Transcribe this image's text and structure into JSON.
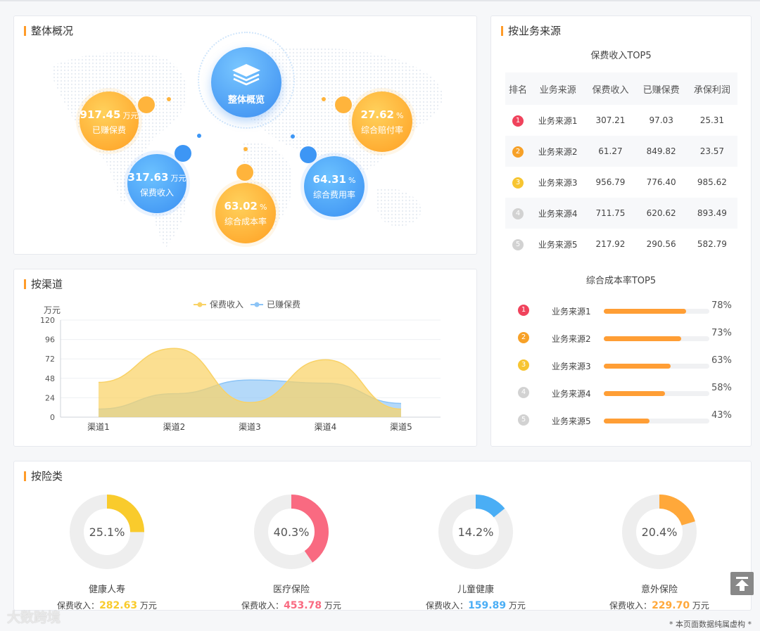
{
  "overview": {
    "title": "整体概况",
    "center_label": "整体概览",
    "metrics": [
      {
        "value": "917.45",
        "unit": "万元",
        "label": "已赚保费"
      },
      {
        "value": "317.63",
        "unit": "万元",
        "label": "保费收入"
      },
      {
        "value": "63.02",
        "unit": "%",
        "label": "综合成本率"
      },
      {
        "value": "64.31",
        "unit": "%",
        "label": "综合费用率"
      },
      {
        "value": "27.62",
        "unit": "%",
        "label": "综合赔付率"
      }
    ]
  },
  "channel": {
    "title": "按渠道",
    "chart_data": {
      "type": "area",
      "categories": [
        "渠道1",
        "渠道2",
        "渠道3",
        "渠道4",
        "渠道5"
      ],
      "series": [
        {
          "name": "保费收入",
          "values": [
            43,
            85,
            18,
            71,
            10
          ],
          "color": "#f9d266"
        },
        {
          "name": "已赚保费",
          "values": [
            10,
            29,
            46,
            42,
            17
          ],
          "color": "#8cc4f6"
        }
      ],
      "ylabel": "万元",
      "yticks": [
        "0",
        "24",
        "48",
        "72",
        "96",
        "120"
      ],
      "ylim": [
        0,
        120
      ],
      "grid": true,
      "legend": "top-center"
    }
  },
  "source": {
    "title": "按业务来源",
    "table_title": "保费收入TOP5",
    "headers": [
      "排名",
      "业务来源",
      "保费收入",
      "已赚保费",
      "承保利润"
    ],
    "rows": [
      {
        "rank": "1",
        "name": "业务来源1",
        "income": "307.21",
        "earned": "97.03",
        "profit": "25.31"
      },
      {
        "rank": "2",
        "name": "业务来源2",
        "income": "61.27",
        "earned": "849.82",
        "profit": "23.57"
      },
      {
        "rank": "3",
        "name": "业务来源3",
        "income": "956.79",
        "earned": "776.40",
        "profit": "985.62"
      },
      {
        "rank": "4",
        "name": "业务来源4",
        "income": "711.75",
        "earned": "620.62",
        "profit": "893.49"
      },
      {
        "rank": "5",
        "name": "业务来源5",
        "income": "217.92",
        "earned": "290.56",
        "profit": "582.79"
      }
    ],
    "rank_colors": [
      "#f0435c",
      "#f7a128",
      "#f7c531",
      "#d2d2d2",
      "#d2d2d2"
    ],
    "cost_title": "综合成本率TOP5",
    "cost_rows": [
      {
        "rank": "1",
        "name": "业务来源1",
        "pct": "78%",
        "value": 78
      },
      {
        "rank": "2",
        "name": "业务来源2",
        "pct": "73%",
        "value": 73
      },
      {
        "rank": "3",
        "name": "业务来源3",
        "pct": "63%",
        "value": 63
      },
      {
        "rank": "4",
        "name": "业务来源4",
        "pct": "58%",
        "value": 58
      },
      {
        "rank": "5",
        "name": "业务来源5",
        "pct": "43%",
        "value": 43
      }
    ]
  },
  "types": {
    "title": "按险类",
    "income_prefix": "保费收入：",
    "unit": "万元",
    "items": [
      {
        "name": "健康人寿",
        "pct_label": "25.1%",
        "pct": 25.1,
        "income": "282.63",
        "color": "#f9cb2c"
      },
      {
        "name": "医疗保险",
        "pct_label": "40.3%",
        "pct": 40.3,
        "income": "453.78",
        "color": "#f96a81"
      },
      {
        "name": "儿童健康",
        "pct_label": "14.2%",
        "pct": 14.2,
        "income": "159.89",
        "color": "#4aaef5"
      },
      {
        "name": "意外保险",
        "pct_label": "20.4%",
        "pct": 20.4,
        "income": "229.70",
        "color": "#ffa83a"
      }
    ]
  },
  "watermark": "大数跨境",
  "footnote": "* 本页面数据纯属虚构 *"
}
